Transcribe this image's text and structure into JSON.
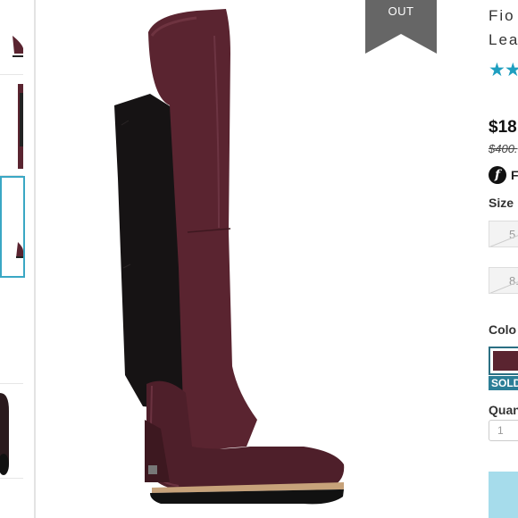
{
  "ribbon": {
    "text": "OUT",
    "color": "#666666"
  },
  "product": {
    "title_line1": "Fio",
    "title_line2": "Lea",
    "stars": "★★",
    "price": "$18",
    "original_price": "$400.",
    "fulfilled_icon": "f",
    "fulfilled_text": "F"
  },
  "size": {
    "label": "Size",
    "options": [
      "5",
      "8.5"
    ]
  },
  "color": {
    "label": "Colo",
    "selected_swatch": "#5a2430",
    "badge": "SOLD"
  },
  "quantity": {
    "label": "Quan",
    "value": "1"
  },
  "icons": {
    "thumbnails": [
      "boot-thumbnail-icon"
    ],
    "star": "star-icon",
    "f-badge": "fulfilled-icon"
  },
  "colors": {
    "accent": "#1f9fc0",
    "active_thumb_border": "#3aa7c4",
    "boot": "#5a2430",
    "cta": "#a6dceb"
  }
}
